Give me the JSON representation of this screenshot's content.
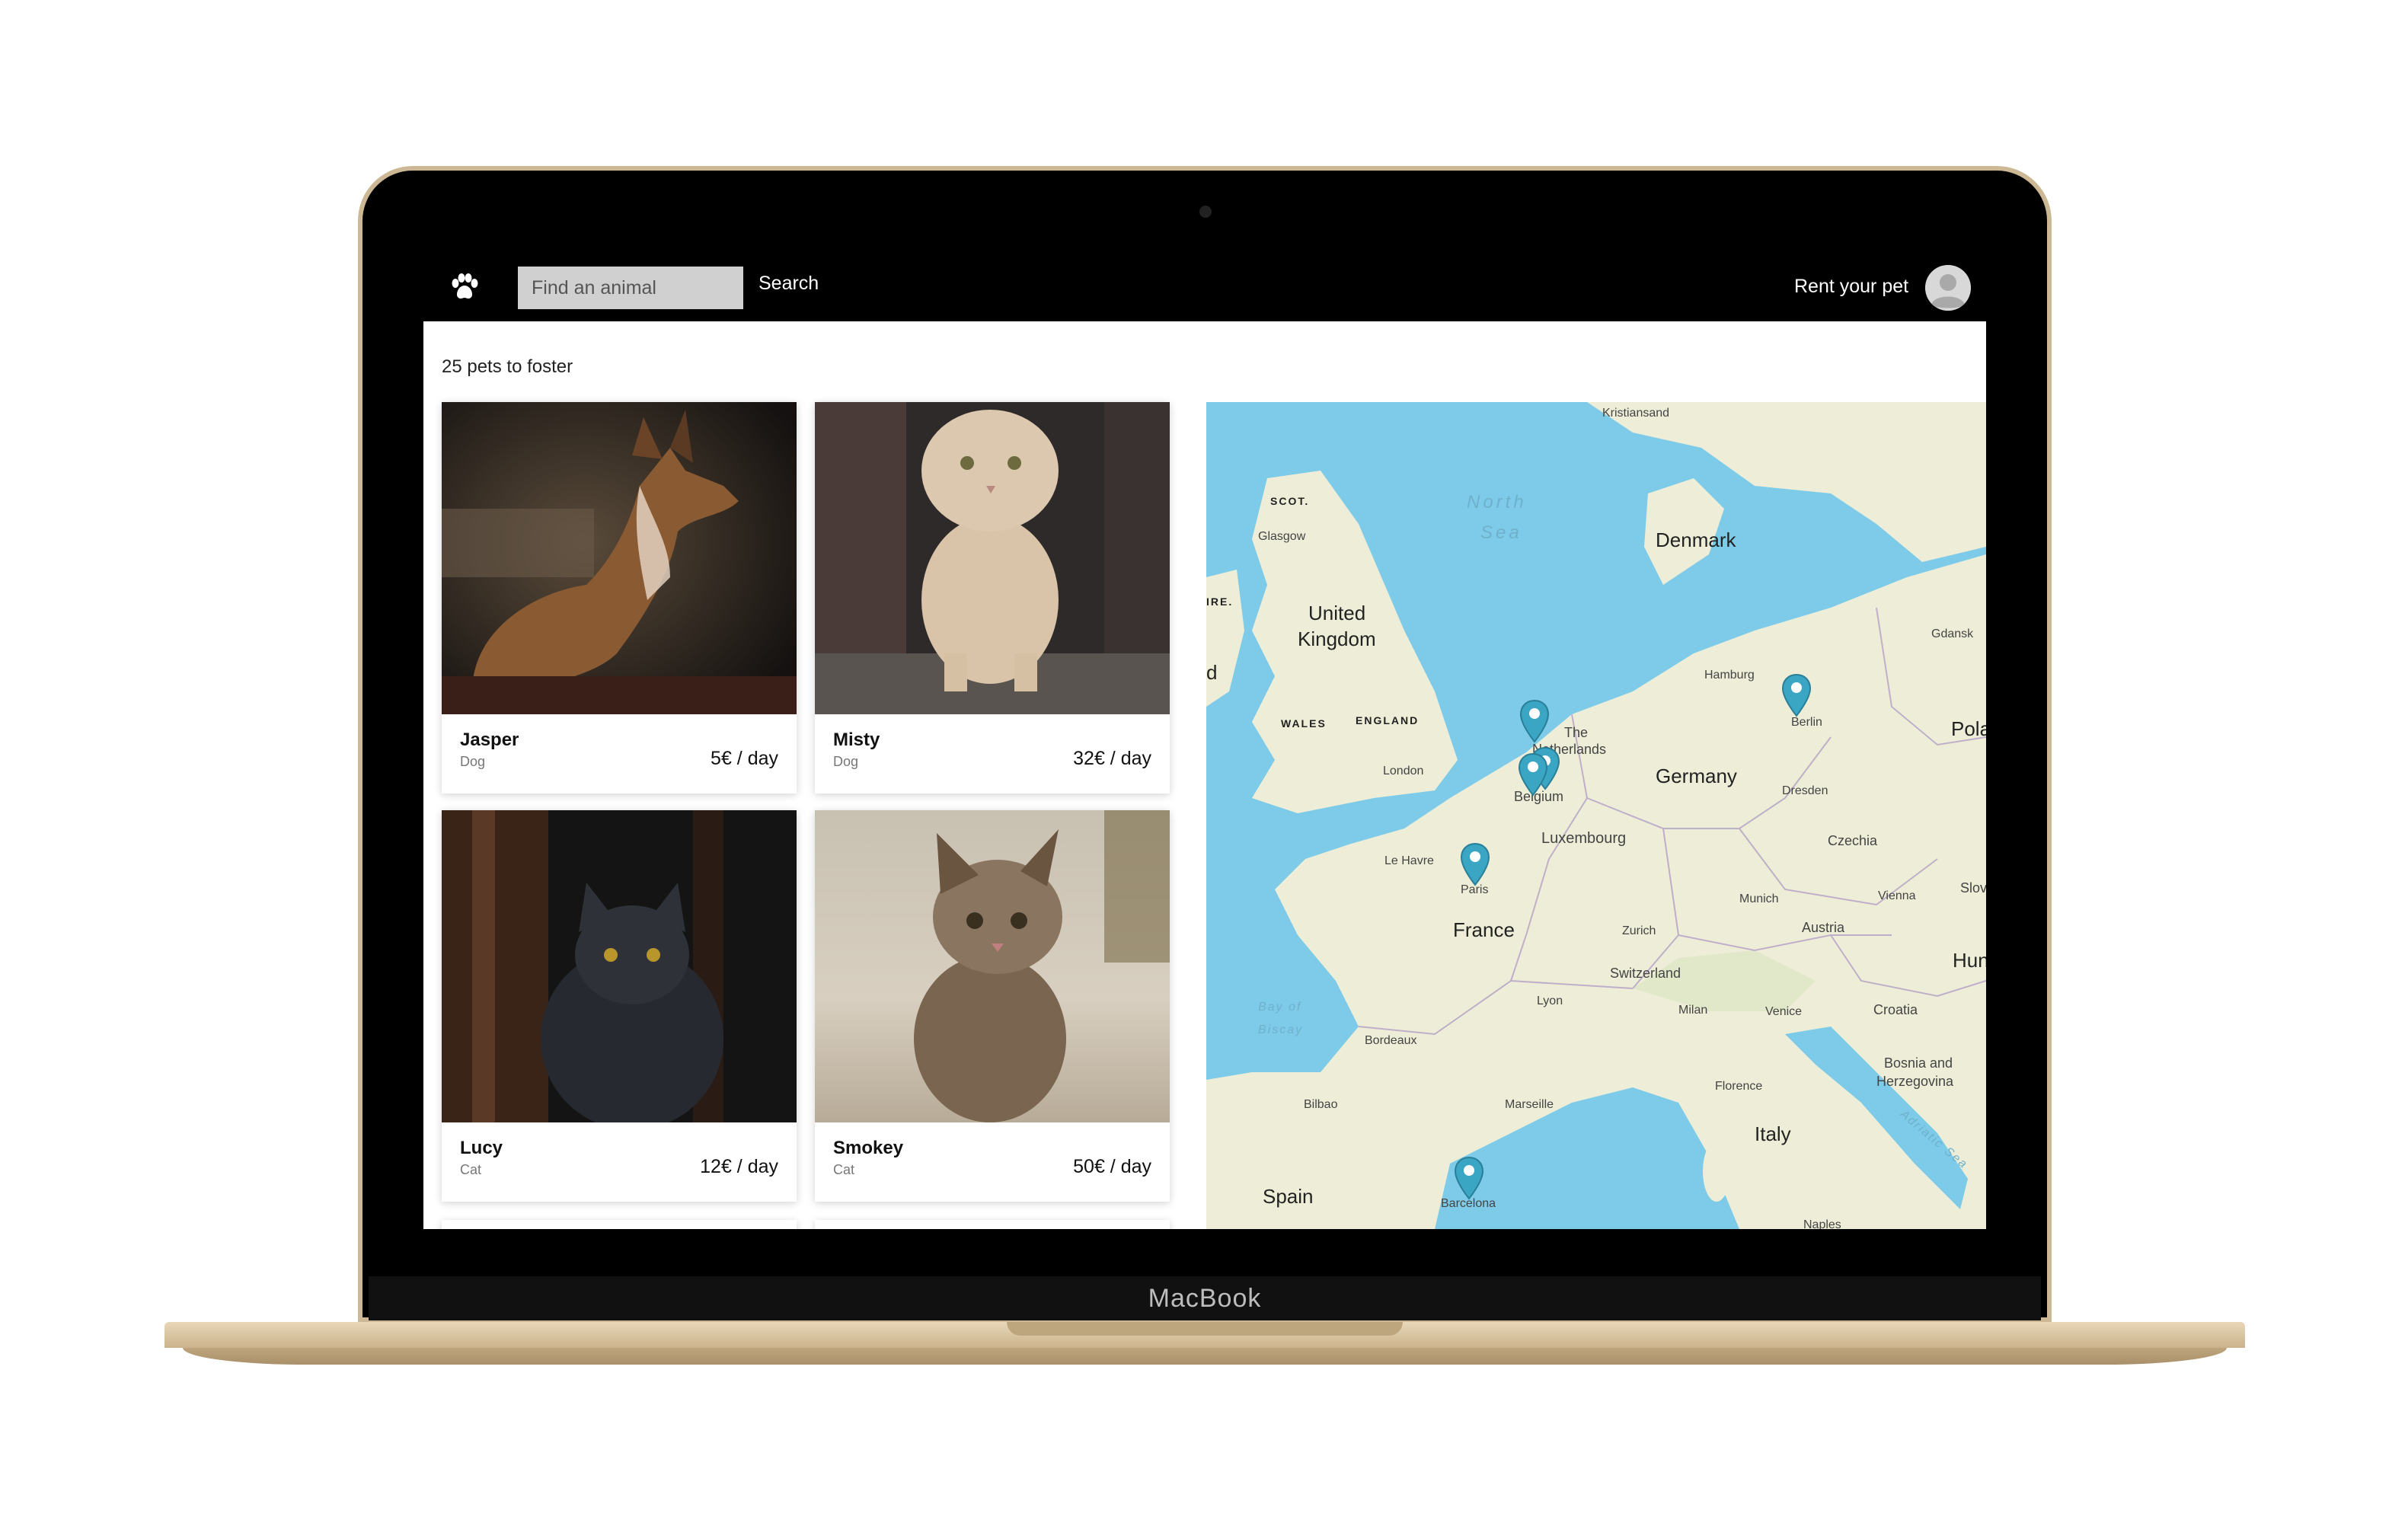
{
  "device": {
    "brand": "MacBook"
  },
  "header": {
    "logo_icon": "paw-icon",
    "search_placeholder": "Find an animal",
    "search_label": "Search",
    "rent_label": "Rent your pet",
    "avatar_icon": "user-avatar-icon"
  },
  "results": {
    "count_label": "25 pets to foster",
    "pets": [
      {
        "name": "Jasper",
        "type": "Dog",
        "price": "5€ / day"
      },
      {
        "name": "Misty",
        "type": "Dog",
        "price": "32€ / day"
      },
      {
        "name": "Lucy",
        "type": "Cat",
        "price": "12€ / day"
      },
      {
        "name": "Smokey",
        "type": "Cat",
        "price": "50€ / day"
      }
    ]
  },
  "map": {
    "seas": [
      "North",
      "Sea",
      "Bay of",
      "Biscay",
      "Adriatic Sea"
    ],
    "countries": [
      "Denmark",
      "United",
      "Kingdom",
      "Germany",
      "Belgium",
      "Luxembourg",
      "France",
      "Switzerland",
      "Czechia",
      "Austria",
      "Croatia",
      "Bosnia and",
      "Herzegovina",
      "Italy",
      "Spain",
      "Polar",
      "Hung",
      "Slova",
      "The",
      "Netherlands",
      "d"
    ],
    "regions": [
      "SCOT.",
      "WALES",
      "ENGLAND",
      "IRE."
    ],
    "cities": [
      "Kristiansand",
      "Glasgow",
      "Gdansk",
      "Hamburg",
      "Berlin",
      "London",
      "Dresden",
      "Le Havre",
      "Paris",
      "Munich",
      "Vienna",
      "Zurich",
      "Lyon",
      "Milan",
      "Venice",
      "Bordeaux",
      "Florence",
      "Bilbao",
      "Marseille",
      "Barcelona",
      "Naples"
    ],
    "marker_color": "#3aa6c4"
  },
  "colors": {
    "water": "#7dcbe8",
    "land": "#eeeed8",
    "topbar": "#000000",
    "input": "#d0d0d0"
  }
}
